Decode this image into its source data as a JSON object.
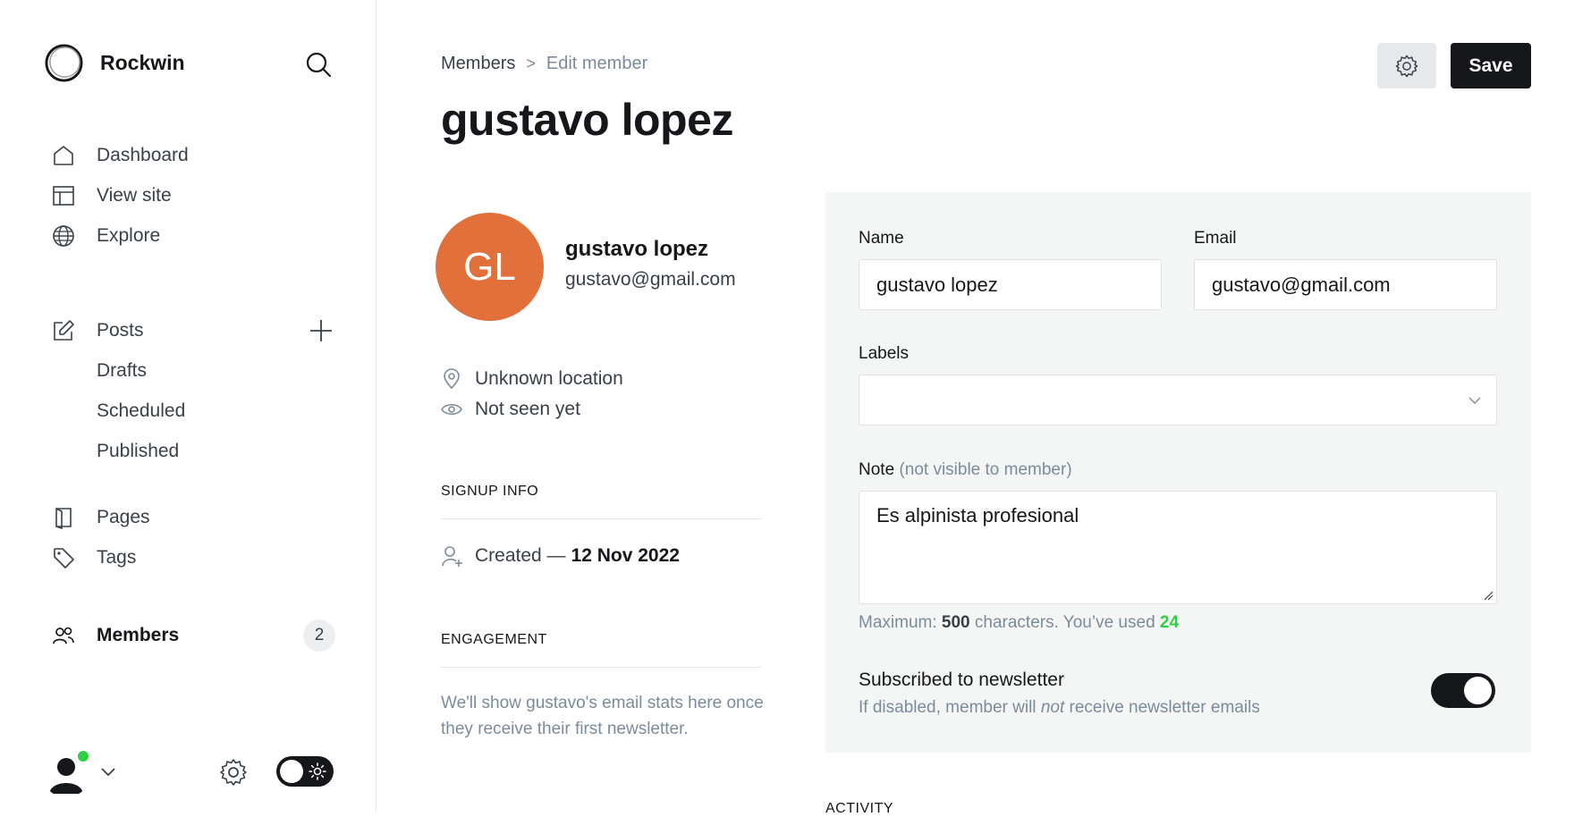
{
  "sidebar": {
    "brand": "Rockwin",
    "nav": [
      {
        "label": "Dashboard",
        "icon": "home-icon"
      },
      {
        "label": "View site",
        "icon": "layout-icon"
      },
      {
        "label": "Explore",
        "icon": "globe-icon"
      }
    ],
    "posts": {
      "label": "Posts",
      "icon": "edit-icon",
      "sub": [
        "Drafts",
        "Scheduled",
        "Published"
      ]
    },
    "nav2": [
      {
        "label": "Pages",
        "icon": "page-icon"
      },
      {
        "label": "Tags",
        "icon": "tag-icon"
      },
      {
        "label": "Members",
        "icon": "members-icon",
        "count": "2",
        "active": true
      }
    ]
  },
  "header": {
    "breadcrumb": [
      "Members",
      "Edit member"
    ],
    "title": "gustavo lopez",
    "save_label": "Save"
  },
  "member": {
    "initials": "GL",
    "name": "gustavo lopez",
    "email": "gustavo@gmail.com",
    "location": "Unknown location",
    "seen": "Not seen yet",
    "avatar_color": "#e2703a"
  },
  "signup": {
    "heading": "SIGNUP INFO",
    "created_label": "Created —",
    "created_date": "12 Nov 2022"
  },
  "engagement": {
    "heading": "ENGAGEMENT",
    "text": "We'll show gustavo's email stats here once they receive their first newsletter."
  },
  "form": {
    "name_label": "Name",
    "name_value": "gustavo lopez",
    "email_label": "Email",
    "email_value": "gustavo@gmail.com",
    "labels_label": "Labels",
    "note_label": "Note",
    "note_hint": "(not visible to member)",
    "note_value": "Es alpinista profesional",
    "counter_prefix": "Maximum:",
    "counter_max": "500",
    "counter_mid": "characters. You’ve used",
    "counter_used": "24",
    "newsletter_title": "Subscribed to newsletter",
    "newsletter_desc_1": "If disabled, member will",
    "newsletter_desc_em": "not",
    "newsletter_desc_2": "receive newsletter emails",
    "newsletter_on": true
  },
  "activity": {
    "heading": "ACTIVITY"
  },
  "colors": {
    "accent_green": "#30cf43",
    "dark": "#15171a"
  }
}
